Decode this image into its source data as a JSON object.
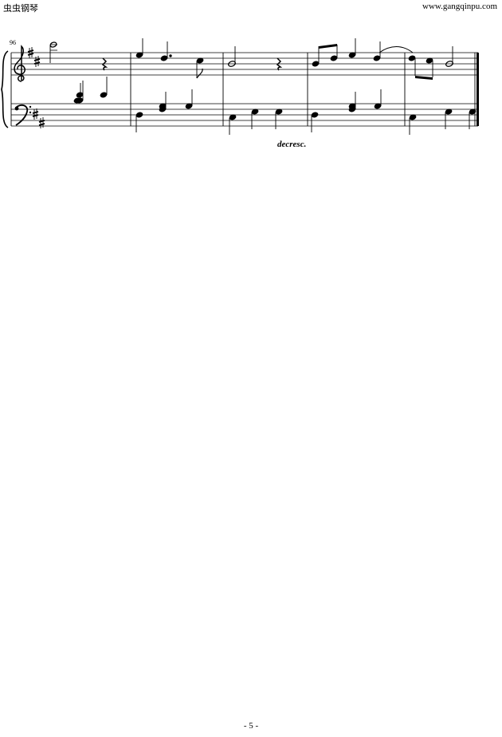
{
  "header": {
    "site_name_cn": "虫虫钢琴",
    "site_url": "www.gangqinpu.com"
  },
  "score": {
    "start_measure": "96",
    "key_signature": "D major (2 sharps)",
    "dynamic_marking": "decresc.",
    "measure_count": 5
  },
  "footer": {
    "page_number": "- 5 -"
  }
}
